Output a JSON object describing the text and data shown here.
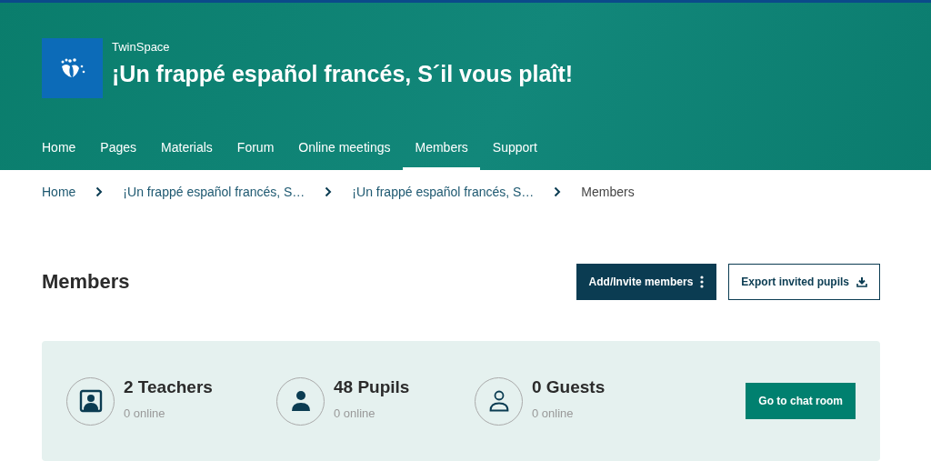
{
  "header": {
    "brand": "TwinSpace",
    "title": "¡Un frappé español francés, S´il vous plaît!"
  },
  "nav": [
    {
      "label": "Home",
      "selected": false
    },
    {
      "label": "Pages",
      "selected": false
    },
    {
      "label": "Materials",
      "selected": false
    },
    {
      "label": "Forum",
      "selected": false
    },
    {
      "label": "Online meetings",
      "selected": false
    },
    {
      "label": "Members",
      "selected": true
    },
    {
      "label": "Support",
      "selected": false
    }
  ],
  "breadcrumb": [
    {
      "label": "Home",
      "current": false
    },
    {
      "label": "¡Un frappé español francés, S…",
      "current": false
    },
    {
      "label": "¡Un frappé español francés, S…",
      "current": false
    },
    {
      "label": "Members",
      "current": true
    }
  ],
  "page_title": "Members",
  "actions": {
    "add": "Add/Invite members",
    "export": "Export invited pupils"
  },
  "stats": [
    {
      "kind": "teachers",
      "count": "2 Teachers",
      "online": "0 online"
    },
    {
      "kind": "pupils",
      "count": "48 Pupils",
      "online": "0 online"
    },
    {
      "kind": "guests",
      "count": "0 Guests",
      "online": "0 online"
    }
  ],
  "chat_button": "Go to chat room"
}
